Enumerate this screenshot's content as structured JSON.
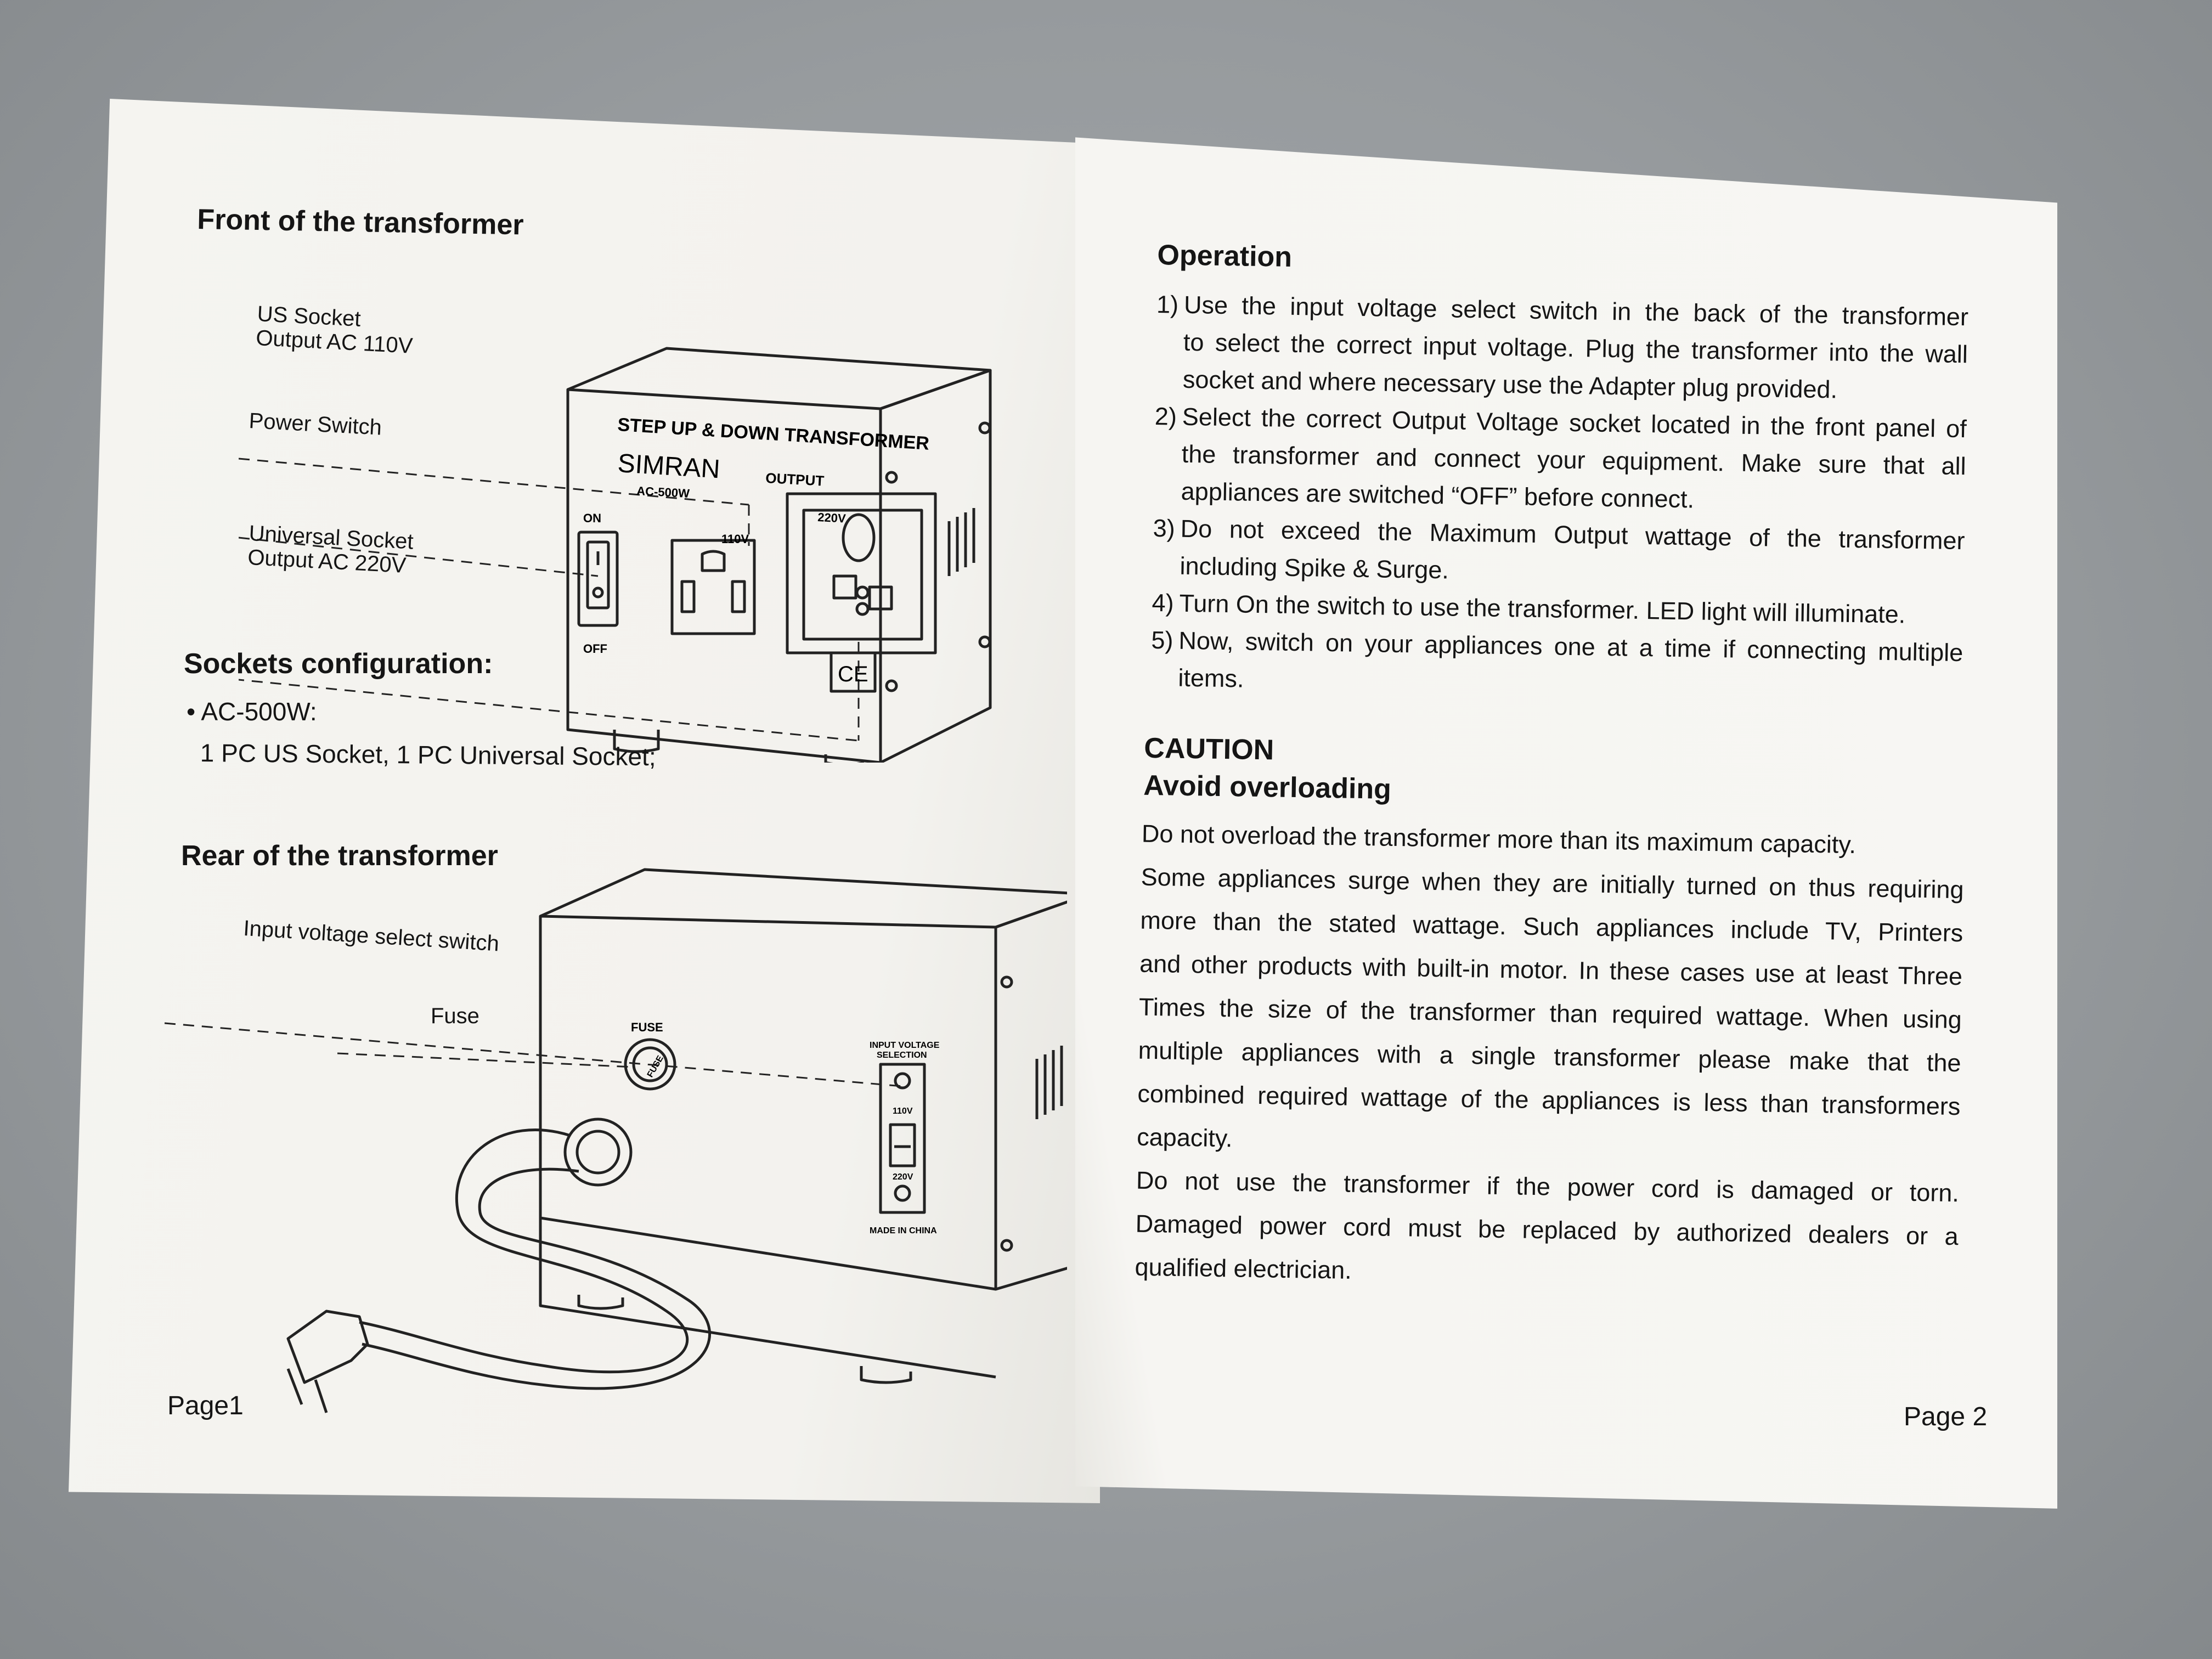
{
  "page1": {
    "front_title": "Front of the transformer",
    "front_labels": {
      "us_socket": "US Socket\nOutput AC 110V",
      "power_switch": "Power Switch",
      "universal_socket": "Universal Socket\nOutput AC 220V"
    },
    "front_device": {
      "title": "STEP UP & DOWN TRANSFORMER",
      "brand": "SIMRAN",
      "model": "AC-500W",
      "output_label": "OUTPUT",
      "on_label": "ON",
      "off_label": "OFF",
      "us_voltage": "110V",
      "universal_voltage": "220V",
      "ce_mark": "CE"
    },
    "sockets_title": "Sockets configuration:",
    "sockets_bullet": "AC-500W:",
    "sockets_detail": "1 PC US Socket, 1 PC Universal Socket;",
    "rear_title": "Rear of the transformer",
    "rear_labels": {
      "input_switch": "Input voltage select switch",
      "fuse": "Fuse"
    },
    "rear_device": {
      "fuse_label": "FUSE",
      "fuse_cap": "FUSE",
      "input_selection": "INPUT VOLTAGE\nSELECTION",
      "v110": "110V",
      "v220": "220V",
      "made_in": "MADE IN CHINA"
    },
    "page_label": "Page1"
  },
  "page2": {
    "operation_title": "Operation",
    "operation_items": [
      {
        "num": "1)",
        "lines": [
          "Use the input voltage select switch in the back of the transformer",
          "to select the correct input voltage. Plug the transformer into the wall",
          "socket and where necessary use the Adapter plug provided."
        ]
      },
      {
        "num": "2)",
        "lines": [
          "Select the correct Output Voltage socket located in the front panel of",
          "the transformer and connect your equipment. Make sure that all",
          "appliances are switched “OFF” before connect."
        ]
      },
      {
        "num": "3)",
        "lines": [
          "Do not exceed the Maximum Output wattage of the transformer",
          "including Spike & Surge."
        ]
      },
      {
        "num": "4)",
        "lines": [
          "Turn On the switch to use the transformer. LED light will illuminate."
        ]
      },
      {
        "num": "5)",
        "lines": [
          "Now, switch on your appliances one at a time if connecting multiple",
          "items."
        ]
      }
    ],
    "caution_title": "CAUTION",
    "caution_subtitle": "Avoid overloading",
    "caution_paragraphs": [
      [
        "Do not overload the transformer more than its maximum capacity."
      ],
      [
        "Some appliances surge when they are initially turned on thus requiring",
        "more than the stated wattage. Such appliances include TV, Printers",
        "and other products with built-in motor. In these cases use at least Three",
        "Times the size of the transformer than required wattage. When using",
        "multiple appliances with a single transformer please make that the",
        "combined required wattage of the appliances is less than transformers",
        "capacity."
      ],
      [
        "Do not use the transformer if the power cord is damaged or torn.",
        "Damaged power cord must be replaced by authorized dealers or a",
        "qualified electrician."
      ]
    ],
    "page_label": "Page 2"
  }
}
